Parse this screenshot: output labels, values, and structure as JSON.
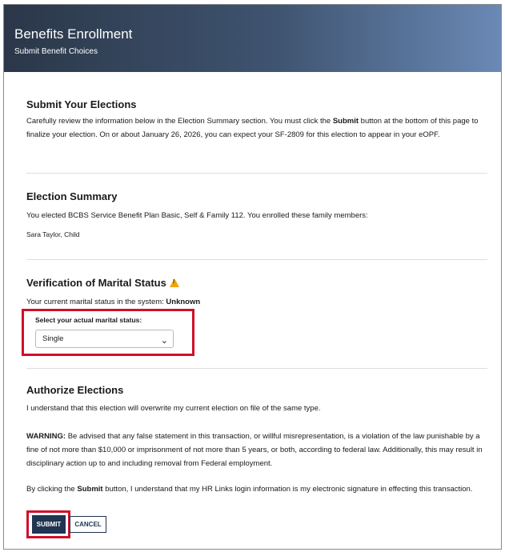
{
  "header": {
    "title": "Benefits Enrollment",
    "subtitle": "Submit Benefit Choices"
  },
  "submit_section": {
    "heading": "Submit Your Elections",
    "text_pre": "Carefully review the information below in the Election Summary section. You must click the ",
    "text_bold": "Submit",
    "text_post": " button at the bottom of this page to finalize your election. On or about January 26, 2026, you can expect your SF-2809 for this election to appear in your eOPF."
  },
  "summary": {
    "heading": "Election Summary",
    "text": "You elected BCBS Service Benefit Plan Basic, Self & Family 112. You enrolled these family members:",
    "member": "Sara Taylor, Child"
  },
  "marital": {
    "heading": "Verification of Marital Status",
    "status_label": "Your current marital status in the system: ",
    "status_value": "Unknown",
    "select_label": "Select your actual marital status:",
    "select_value": "Single"
  },
  "authorize": {
    "heading": "Authorize Elections",
    "text1": "I understand that this election will overwrite my current election on file of the same type.",
    "warning_label": "WARNING:",
    "warning_text": "  Be advised that any false statement in this transaction, or willful misrepresentation, is a violation of the law punishable by a fine of not more than $10,000 or imprisonment of not more than 5 years, or both, according to federal law. Additionally, this may result in disciplinary action up to and including removal from Federal employment.",
    "sig_pre": "By clicking the ",
    "sig_bold": "Submit",
    "sig_post": " button, I understand that my HR Links login information is my electronic signature in effecting this transaction."
  },
  "buttons": {
    "submit": "SUBMIT",
    "cancel": "CANCEL"
  },
  "colors": {
    "highlight": "#d0102a",
    "primary_button": "#1f3550",
    "warning": "#f0a500"
  }
}
